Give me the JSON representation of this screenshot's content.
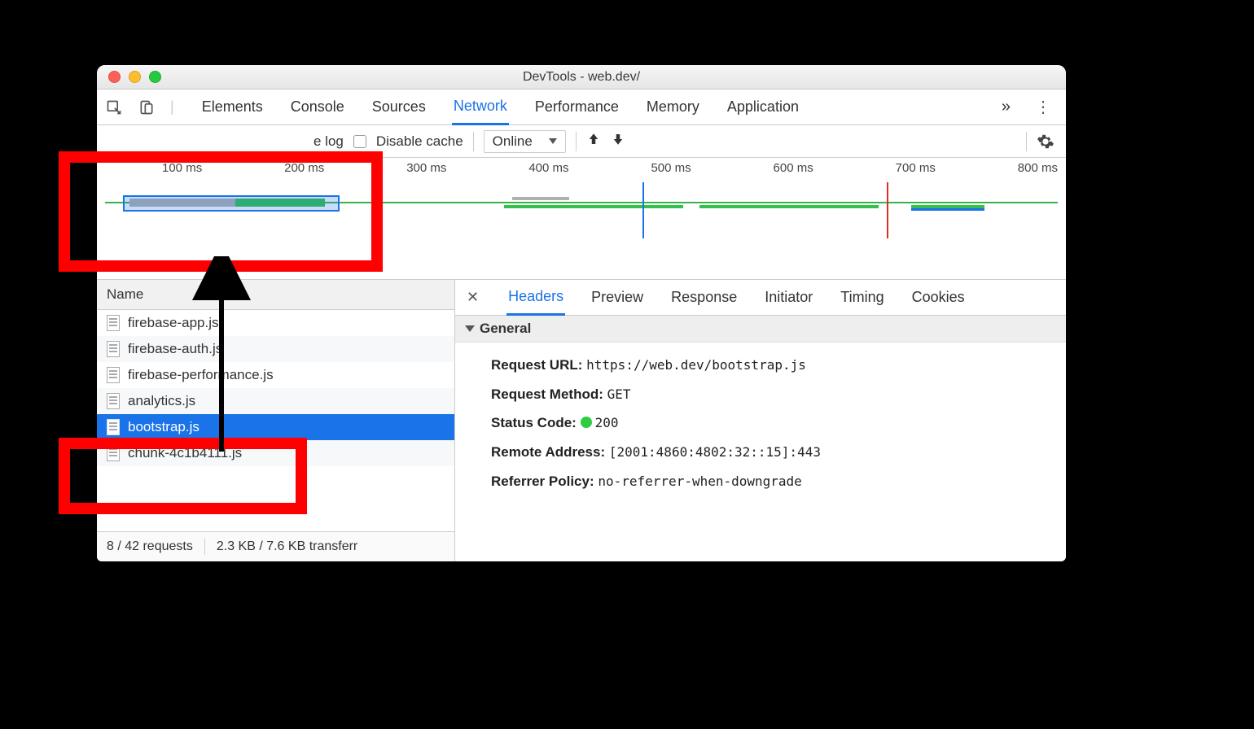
{
  "window": {
    "title": "DevTools - web.dev/"
  },
  "panelTabs": [
    "Elements",
    "Console",
    "Sources",
    "Network",
    "Performance",
    "Memory",
    "Application"
  ],
  "panelActive": "Network",
  "overflowGlyph": "»",
  "toolbar": {
    "preserve_log_label": "e log",
    "disable_cache_label": "Disable cache",
    "throttle": "Online"
  },
  "timeline": {
    "ticks": [
      "100 ms",
      "200 ms",
      "300 ms",
      "400 ms",
      "500 ms",
      "600 ms",
      "700 ms",
      "800 ms"
    ]
  },
  "nameHeader": "Name",
  "files": [
    {
      "name": "firebase-app.js",
      "selected": false
    },
    {
      "name": "firebase-auth.js",
      "selected": false
    },
    {
      "name": "firebase-performance.js",
      "selected": false
    },
    {
      "name": "analytics.js",
      "selected": false
    },
    {
      "name": "bootstrap.js",
      "selected": true
    },
    {
      "name": "chunk-4c1b4111.js",
      "selected": false
    }
  ],
  "statusBar": {
    "requests": "8 / 42 requests",
    "transfer": "2.3 KB / 7.6 KB transferr"
  },
  "detailTabs": [
    "Headers",
    "Preview",
    "Response",
    "Initiator",
    "Timing",
    "Cookies"
  ],
  "detailActive": "Headers",
  "generalHeader": "General",
  "general": {
    "request_url_label": "Request URL:",
    "request_url": "https://web.dev/bootstrap.js",
    "request_method_label": "Request Method:",
    "request_method": "GET",
    "status_code_label": "Status Code:",
    "status_code": "200",
    "remote_address_label": "Remote Address:",
    "remote_address": "[2001:4860:4802:32::15]:443",
    "referrer_policy_label": "Referrer Policy:",
    "referrer_policy": "no-referrer-when-downgrade"
  }
}
